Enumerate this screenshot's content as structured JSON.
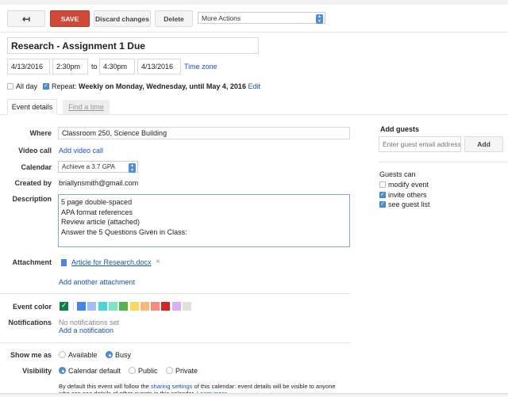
{
  "toolbar": {
    "back_icon": "back-arrow-icon",
    "save": "SAVE",
    "discard": "Discard changes",
    "delete": "Delete",
    "more_actions": "More Actions"
  },
  "event": {
    "title": "Research - Assignment 1 Due",
    "start_date": "4/13/2016",
    "start_time": "2:30pm",
    "to": "to",
    "end_time": "4:30pm",
    "end_date": "4/13/2016",
    "time_zone": "Time zone",
    "all_day_label": "All day",
    "all_day": false,
    "repeat": true,
    "repeat_label": "Repeat:",
    "repeat_text": "Weekly on Monday, Wednesday, until May 4, 2016",
    "repeat_edit": "Edit"
  },
  "tabs": [
    {
      "label": "Event details",
      "active": true
    },
    {
      "label": "Find a time",
      "active": false
    }
  ],
  "details": {
    "where_label": "Where",
    "where": "Classroom 250, Science Building",
    "video_label": "Video call",
    "video_link": "Add video call",
    "calendar_label": "Calendar",
    "calendar": "Achieve a 3.7 GPA",
    "created_label": "Created by",
    "created_by": "briallynsmith@gmail.com",
    "description_label": "Description",
    "description": "5 page double-spaced\nAPA format references\nReview article (attached)\nAnswer the 5 Questions Given in Class:",
    "attachment_label": "Attachment",
    "attachment": "Article for Research.docx",
    "add_attachment": "Add another attachment",
    "color_label": "Event color",
    "colors": [
      "#0b8043",
      "#4285f4",
      "#a4bdfc",
      "#46d6db",
      "#7ae7bf",
      "#51b749",
      "#fbd75b",
      "#ffb878",
      "#ff887c",
      "#dc2127",
      "#dbadff",
      "#e1e1e1"
    ],
    "selected_color": "#0b8043",
    "notifications_label": "Notifications",
    "no_notifications": "No notifications set",
    "add_notification": "Add a notification",
    "show_me_as_label": "Show me as",
    "available": "Available",
    "busy": "Busy",
    "show_me_as": "Busy",
    "visibility_label": "Visibility",
    "vis_default": "Calendar default",
    "vis_public": "Public",
    "vis_private": "Private",
    "visibility": "Calendar default",
    "note_pre": "By default this event will follow the ",
    "note_link": "sharing settings",
    "note_post": " of this calendar: event details will be visible to anyone",
    "note_line2": "who can see details of other events in this calendar.",
    "learn_more": "Learn more"
  },
  "guests": {
    "title": "Add guests",
    "placeholder": "Enter guest email address",
    "add": "Add",
    "can_title": "Guests can",
    "options": [
      {
        "label": "modify event",
        "checked": false
      },
      {
        "label": "invite others",
        "checked": true
      },
      {
        "label": "see guest list",
        "checked": true
      }
    ]
  },
  "accent": "#d14836",
  "link_color": "#1155cc"
}
